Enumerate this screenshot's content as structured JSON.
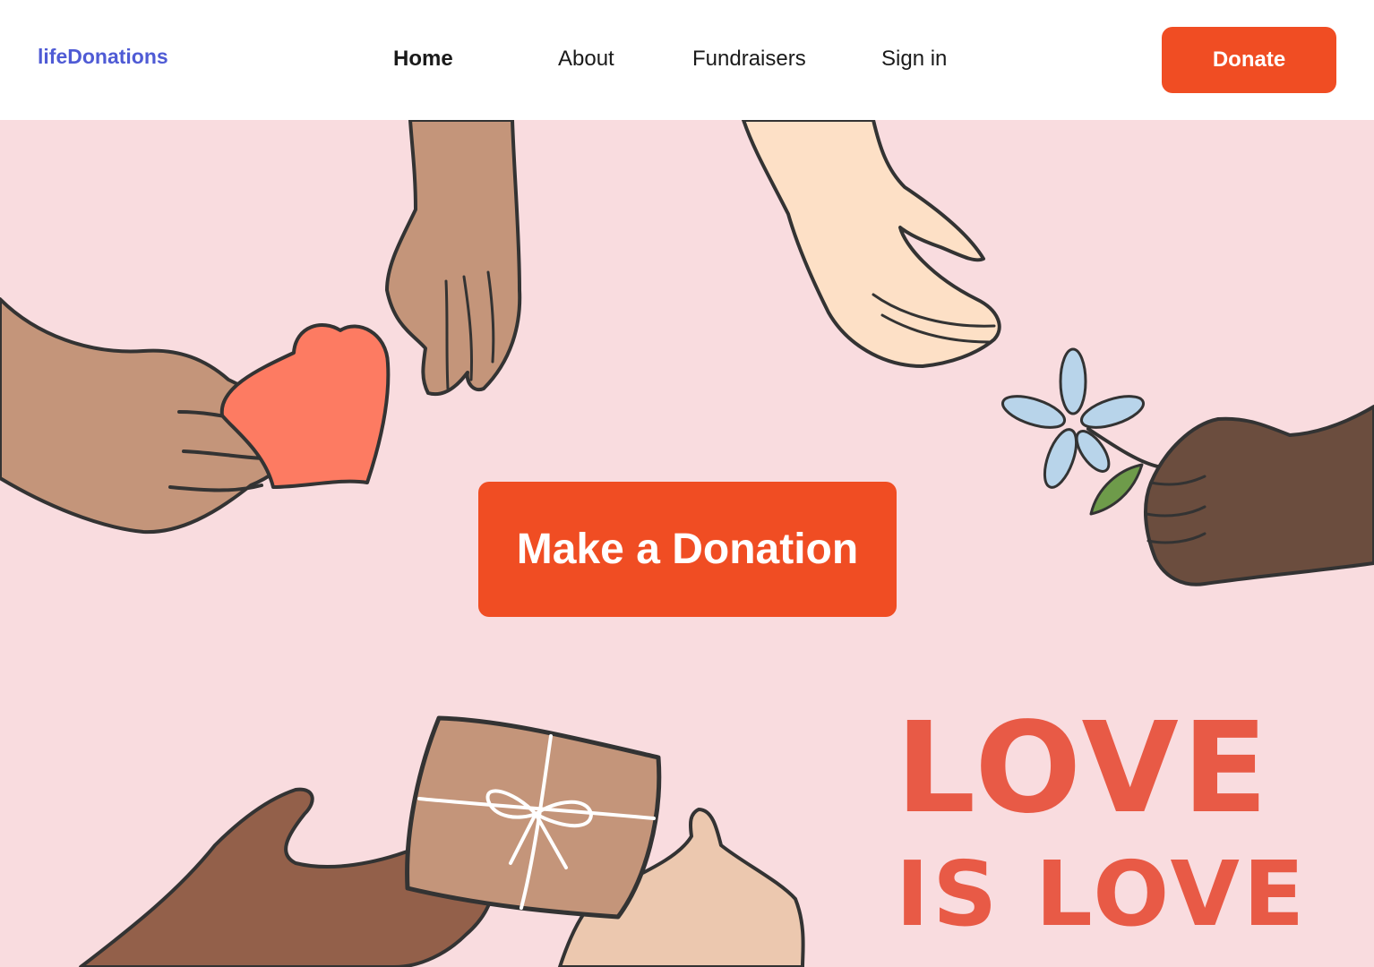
{
  "brand": {
    "name": "lifeDonations",
    "color": "#4f5bd5"
  },
  "page_load_progress": 0.2,
  "nav": {
    "items": [
      {
        "label": "Home",
        "active": true
      },
      {
        "label": "About",
        "active": false
      },
      {
        "label": "Fundraisers",
        "active": false
      },
      {
        "label": "Sign in",
        "active": false
      }
    ],
    "donate_label": "Donate"
  },
  "hero": {
    "cta_label": "Make a Donation",
    "love_line1": "LOVE",
    "love_line2": "IS LOVE",
    "background": "#f9dcdf",
    "accent": "#f04d23",
    "love_color": "#e85a46",
    "illustrations": [
      "hand-with-heart",
      "reaching-hand",
      "open-palm-hand",
      "hand-with-flower",
      "hands-with-gift"
    ]
  }
}
